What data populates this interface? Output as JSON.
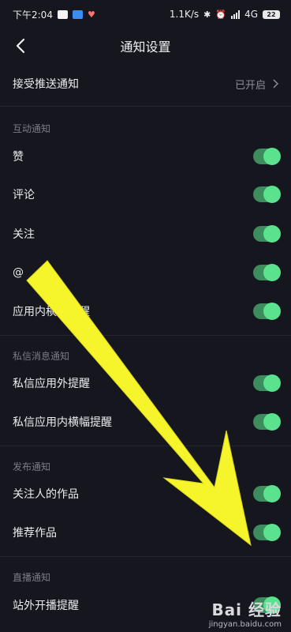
{
  "status_bar": {
    "time": "下午2:04",
    "speed": "1.1K/s",
    "network": "4G",
    "battery": "22"
  },
  "header": {
    "title": "通知设置",
    "back_icon": "back-arrow-icon"
  },
  "push": {
    "label": "接受推送通知",
    "value": "已开启"
  },
  "sections": [
    {
      "title": "互动通知",
      "items": [
        {
          "label": "赞",
          "enabled": true
        },
        {
          "label": "评论",
          "enabled": true
        },
        {
          "label": "关注",
          "enabled": true
        },
        {
          "label": "@",
          "enabled": true
        },
        {
          "label": "应用内横幅提醒",
          "enabled": true
        }
      ]
    },
    {
      "title": "私信消息通知",
      "items": [
        {
          "label": "私信应用外提醒",
          "enabled": true
        },
        {
          "label": "私信应用内横幅提醒",
          "enabled": true
        }
      ]
    },
    {
      "title": "发布通知",
      "items": [
        {
          "label": "关注人的作品",
          "enabled": true
        },
        {
          "label": "推荐作品",
          "enabled": true
        }
      ]
    },
    {
      "title": "直播通知",
      "items": [
        {
          "label": "站外开播提醒",
          "enabled": true
        }
      ]
    }
  ],
  "watermark": {
    "brand": "Bai 经验",
    "site": "jingyan.baidu.com"
  },
  "colors": {
    "background": "#16161f",
    "toggle_track": "#3c8c5d",
    "toggle_knob": "#5be28f",
    "arrow": "#f6f52b"
  }
}
